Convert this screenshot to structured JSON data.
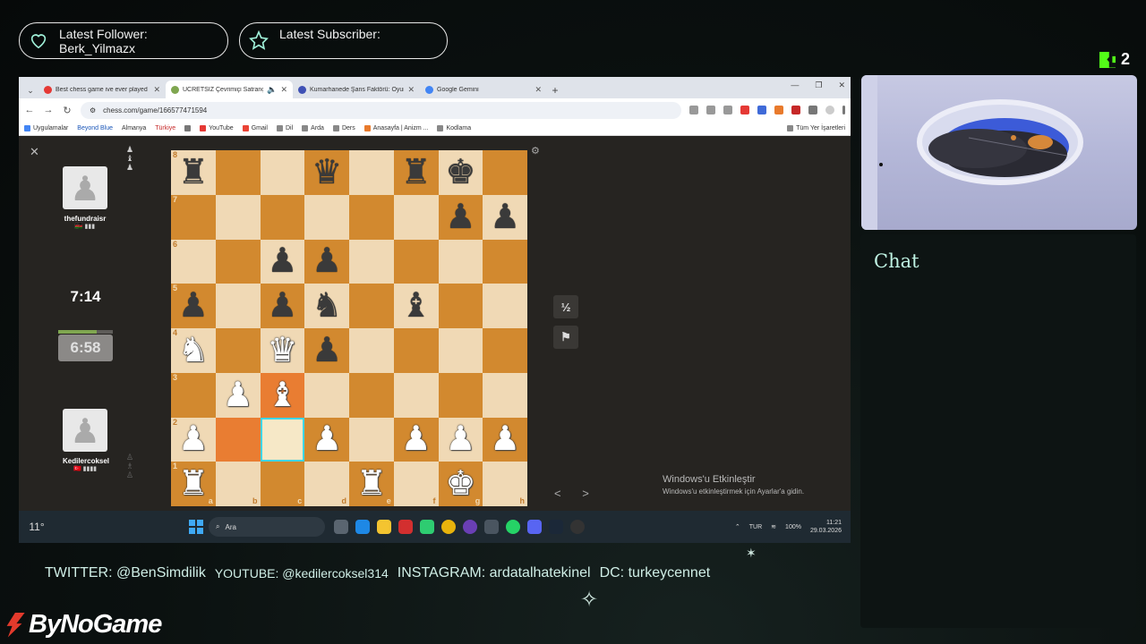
{
  "overlay": {
    "follower_label": "Latest Follower:",
    "follower_name": "Berk_Yilmazx",
    "subscriber_label": "Latest Subscriber:",
    "kick_count": "2",
    "chat_title": "Chat",
    "socials": {
      "twitter": "TWITTER: @BenSimdilik",
      "youtube": "YOUTUBE: @kedilercoksel314",
      "instagram": "INSTAGRAM: ardatalhatekinel",
      "discord": "DC: turkeycennet"
    },
    "sponsor": "ByNoGame"
  },
  "browser": {
    "tabs": [
      {
        "title": "Best chess game ive ever played",
        "favicon_color": "#e53935"
      },
      {
        "title": "ÜCRETSIZ Çevrimiçi Satranç",
        "favicon_color": "#7fa650"
      },
      {
        "title": "Kumarhanede Şans Faktörü: Oyun",
        "favicon_color": "#3f51b5"
      },
      {
        "title": "Google Gemini",
        "favicon_color": "#4285f4"
      }
    ],
    "url": "chess.com/game/166577471594",
    "bookmarks": [
      "Uygulamalar",
      "Beyond Blue",
      "Almanya",
      "Türkiye",
      "",
      "YouTube",
      "Gmail",
      "Dil",
      "Arda",
      "Ders",
      "Anasayfa | Anizm ...",
      "Kodlama"
    ],
    "bookmarks_right": "Tüm Yer İşaretleri"
  },
  "game": {
    "opponent": {
      "name": "thefundraisr",
      "flag": "🇰🇪 ▮▮▮",
      "clock": "7:14",
      "captured": "♟\n♝\n♟"
    },
    "player": {
      "name": "Kedilercoksel",
      "flag": "🇹🇷 ▮▮▮▮",
      "clock": "6:58",
      "captured": "♙\n♗\n♙"
    },
    "player_clock_remaining_fraction": 0.7,
    "buttons": {
      "draw": "½",
      "resign": "⚑"
    },
    "ranks": [
      "8",
      "7",
      "6",
      "5",
      "4",
      "3",
      "2",
      "1"
    ],
    "files": [
      "a",
      "b",
      "c",
      "d",
      "e",
      "f",
      "g",
      "h"
    ],
    "position": [
      [
        "br",
        "",
        "",
        "bq",
        "",
        "br",
        "bk",
        ""
      ],
      [
        "",
        "",
        "",
        "",
        "",
        "",
        "bp",
        "bp"
      ],
      [
        "",
        "",
        "bp",
        "bp",
        "",
        "",
        "",
        ""
      ],
      [
        "bp",
        "",
        "bp",
        "bn",
        "",
        "bb",
        "",
        ""
      ],
      [
        "wn",
        "",
        "wq",
        "bp",
        "",
        "",
        "",
        ""
      ],
      [
        "",
        "wp",
        "wb",
        "",
        "",
        "",
        "",
        ""
      ],
      [
        "wp",
        "",
        "",
        "wp",
        "",
        "wp",
        "wp",
        "wp"
      ],
      [
        "wr",
        "",
        "",
        "",
        "wr",
        "",
        "wk",
        ""
      ]
    ],
    "highlight_from": "b2",
    "highlight_to": "c3",
    "selected_square": "c2",
    "nav_arrows": "< >"
  },
  "windows": {
    "activate_title": "Windows'u Etkinleştir",
    "activate_sub": "Windows'u etkinleştirmek için Ayarlar'a gidin.",
    "search_placeholder": "Ara",
    "weather": "11°",
    "lang": "TUR",
    "battery": "100%",
    "time": "11:21",
    "date": "29.03.2026"
  },
  "colors": {
    "accent": "#53fc18",
    "board_light": "#f0d9b5",
    "board_dark": "#d2892f",
    "chat_title": "#bff3e3"
  }
}
